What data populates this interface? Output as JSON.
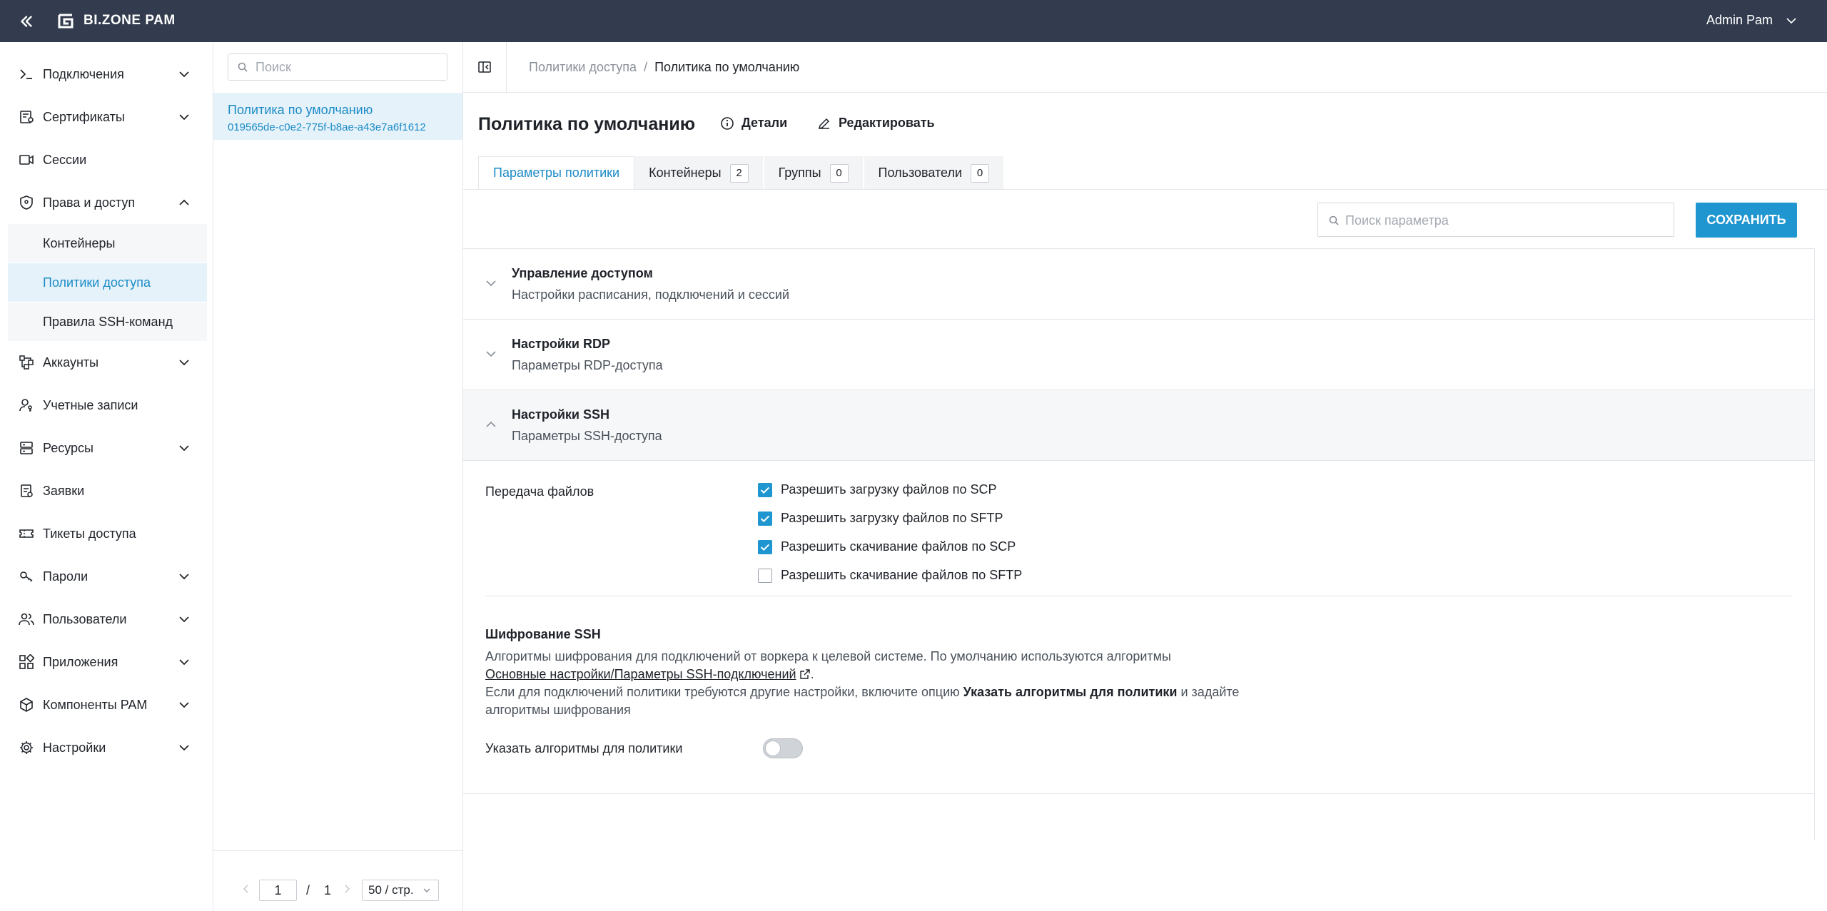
{
  "topbar": {
    "brand": "BI.ZONE PAM",
    "user": "Admin Pam"
  },
  "sidebar": {
    "items": [
      {
        "label": "Подключения",
        "icon": "connections-icon",
        "expandable": true
      },
      {
        "label": "Сертификаты",
        "icon": "certificate-icon",
        "expandable": true
      },
      {
        "label": "Сессии",
        "icon": "session-video-icon",
        "expandable": false
      },
      {
        "label": "Права и доступ",
        "icon": "shield-icon",
        "expandable": true,
        "expanded": true
      },
      {
        "label": "Аккаунты",
        "icon": "accounts-icon",
        "expandable": true
      },
      {
        "label": "Учетные записи",
        "icon": "user-key-icon",
        "expandable": false
      },
      {
        "label": "Ресурсы",
        "icon": "server-icon",
        "expandable": true
      },
      {
        "label": "Заявки",
        "icon": "request-icon",
        "expandable": false
      },
      {
        "label": "Тикеты доступа",
        "icon": "ticket-icon",
        "expandable": false
      },
      {
        "label": "Пароли",
        "icon": "key-icon",
        "expandable": true
      },
      {
        "label": "Пользователи",
        "icon": "users-icon",
        "expandable": true
      },
      {
        "label": "Приложения",
        "icon": "apps-icon",
        "expandable": true
      },
      {
        "label": "Компоненты PAM",
        "icon": "cube-icon",
        "expandable": true
      },
      {
        "label": "Настройки",
        "icon": "gear-icon",
        "expandable": true
      }
    ],
    "subitems": [
      {
        "label": "Контейнеры",
        "active": false
      },
      {
        "label": "Политики доступа",
        "active": true
      },
      {
        "label": "Правила SSH-команд",
        "active": false
      }
    ]
  },
  "list": {
    "search_placeholder": "Поиск",
    "item_name": "Политика по умолчанию",
    "item_id": "019565de-c0e2-775f-b8ae-a43e7a6f1612",
    "pager": {
      "page": "1",
      "slash": "/",
      "total": "1",
      "page_size": "50 / стр."
    }
  },
  "breadcrumb": {
    "parent": "Политики доступа",
    "separator": "/",
    "current": "Политика по умолчанию"
  },
  "page": {
    "title": "Политика по умолчанию",
    "details_label": "Детали",
    "edit_label": "Редактировать"
  },
  "tabs": [
    {
      "label": "Параметры политики",
      "count": null,
      "active": true
    },
    {
      "label": "Контейнеры",
      "count": "2",
      "active": false
    },
    {
      "label": "Группы",
      "count": "0",
      "active": false
    },
    {
      "label": "Пользователи",
      "count": "0",
      "active": false
    }
  ],
  "toolbar": {
    "search_placeholder": "Поиск параметра",
    "save_label": "СОХРАНИТЬ"
  },
  "sections": [
    {
      "title": "Управление доступом",
      "desc": "Настройки расписания, подключений и сессий",
      "open": false
    },
    {
      "title": "Настройки RDP",
      "desc": "Параметры RDP-доступа",
      "open": false
    },
    {
      "title": "Настройки SSH",
      "desc": "Параметры SSH-доступа",
      "open": true
    }
  ],
  "ssh": {
    "file_transfer_label": "Передача файлов",
    "checkboxes": [
      {
        "label": "Разрешить загрузку файлов по SCP",
        "checked": true
      },
      {
        "label": "Разрешить загрузку файлов по SFTP",
        "checked": true
      },
      {
        "label": "Разрешить скачивание файлов по SCP",
        "checked": true
      },
      {
        "label": "Разрешить скачивание файлов по SFTP",
        "checked": false
      }
    ],
    "encryption_title": "Шифрование SSH",
    "enc_line1": "Алгоритмы шифрования для подключений от воркера к целевой системе. По умолчанию используются алгоритмы",
    "enc_link": "Основные настройки/Параметры SSH-подключений",
    "enc_after_link": ".",
    "enc_line3_pre": "Если для подключений политики требуются другие настройки, включите опцию ",
    "enc_line3_bold": "Указать алгоритмы для политики",
    "enc_line3_post": " и задайте",
    "enc_line4": "алгоритмы шифрования",
    "toggle_label": "Указать алгоритмы для политики",
    "toggle_on": false
  },
  "colors": {
    "topbar": "#323c4e",
    "accent": "#1f96d0",
    "active_text": "#1a8bc7",
    "active_bg": "#e6f2fa"
  }
}
